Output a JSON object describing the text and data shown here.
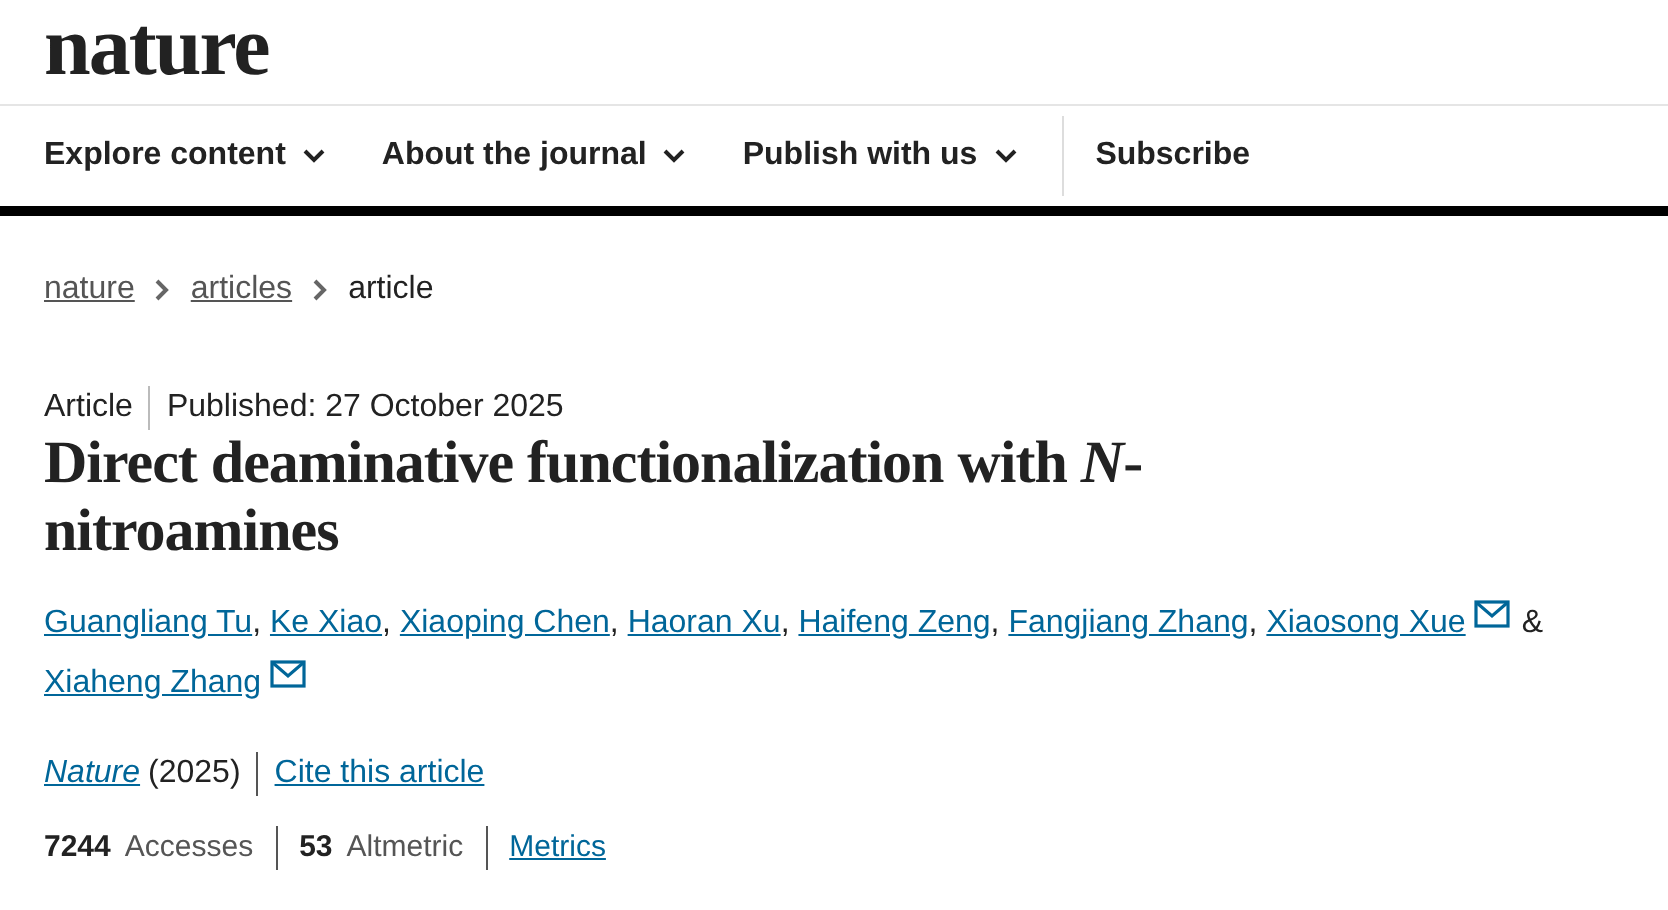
{
  "header": {
    "logo": "nature"
  },
  "nav": [
    {
      "label": "Explore content",
      "dropdown": true
    },
    {
      "label": "About the journal",
      "dropdown": true
    },
    {
      "label": "Publish with us",
      "dropdown": true
    },
    {
      "label": "Subscribe",
      "dropdown": false
    }
  ],
  "breadcrumbs": [
    {
      "label": "nature",
      "current": false
    },
    {
      "label": "articles",
      "current": false
    },
    {
      "label": "article",
      "current": true
    }
  ],
  "article": {
    "type": "Article",
    "published": "Published: 27 October 2025",
    "title": "Direct deaminative functionalization with *N*-nitroamines",
    "authors": [
      {
        "name": "Guangliang Tu",
        "email": false,
        "separator": ","
      },
      {
        "name": "Ke Xiao",
        "email": false,
        "separator": ","
      },
      {
        "name": "Xiaoping Chen",
        "email": false,
        "separator": ","
      },
      {
        "name": "Haoran Xu",
        "email": false,
        "separator": ","
      },
      {
        "name": "Haifeng Zeng",
        "email": false,
        "separator": ","
      },
      {
        "name": "Fangjiang Zhang",
        "email": false,
        "separator": ","
      },
      {
        "name": "Xiaosong Xue",
        "email": true,
        "separator": "&"
      },
      {
        "name": "Xiaheng Zhang",
        "email": true
      }
    ],
    "journal": "Nature",
    "year": "(2025)",
    "cite": "Cite this article",
    "metrics": [
      {
        "count": "7244",
        "label": "Accesses"
      },
      {
        "count": "53",
        "label": "Altmetric"
      }
    ],
    "metrics_link": "Metrics"
  }
}
